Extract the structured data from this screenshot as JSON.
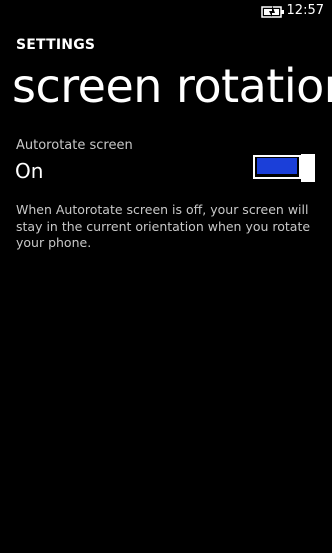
{
  "status_bar": {
    "time": "12:57",
    "battery_icon": "battery-charging-icon"
  },
  "header": {
    "app_title": "SETTINGS",
    "page_title": "screen rotation"
  },
  "autorotate": {
    "label": "Autorotate screen",
    "value": "On",
    "enabled": true,
    "description": "When Autorotate screen is off, your screen will stay in the current orientation when you rotate your phone."
  },
  "colors": {
    "background": "#000000",
    "text": "#ffffff",
    "subtle_text": "#c8c8c8",
    "accent": "#1b3fd9"
  }
}
